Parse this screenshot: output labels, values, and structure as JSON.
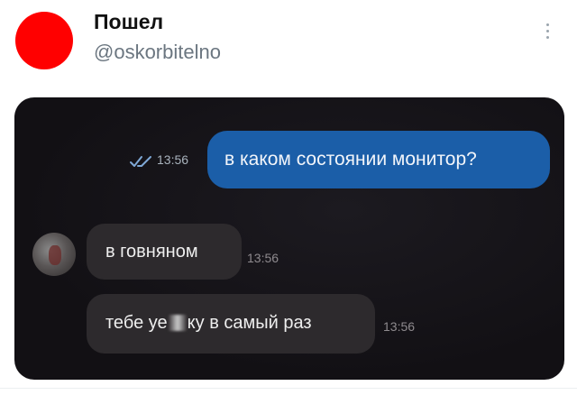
{
  "post": {
    "author_name": "Пошел",
    "author_handle": "@oskorbitelno",
    "avatar_color": "#ff0000",
    "more_icon": "more-vertical-icon"
  },
  "chat": {
    "outgoing": [
      {
        "text": "в каком состоянии монитор?",
        "time": "13:56",
        "status_icon": "double-check-icon",
        "bubble_color": "#1b5ea8"
      }
    ],
    "incoming": [
      {
        "text": "в говняном",
        "time": "13:56"
      },
      {
        "text_before": "тебе уе",
        "text_after": "ку в самый раз",
        "time": "13:56"
      }
    ],
    "peer_avatar_icon": "contact-avatar",
    "incoming_bubble_color": "#2d2a2d",
    "background_color": "#141216"
  }
}
